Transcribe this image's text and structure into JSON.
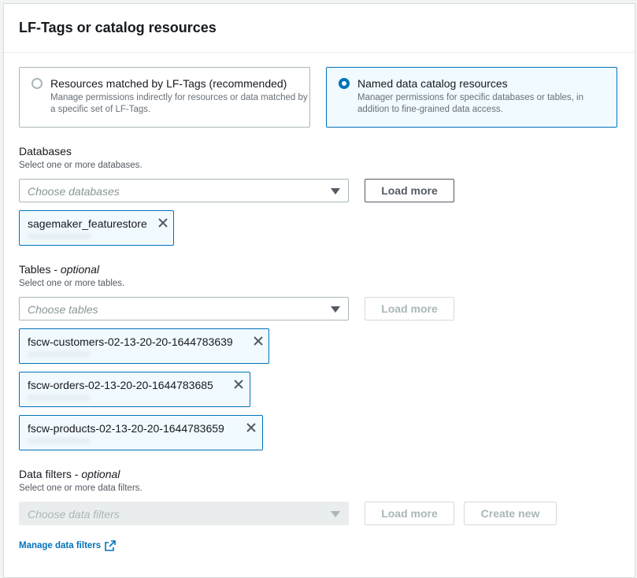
{
  "panel": {
    "title": "LF-Tags or catalog resources"
  },
  "tiles": [
    {
      "title": "Resources matched by LF-Tags (recommended)",
      "desc": "Manage permissions indirectly for resources or data matched by a specific set of LF-Tags.",
      "selected": false
    },
    {
      "title": "Named data catalog resources",
      "desc": "Manager permissions for specific databases or tables, in addition to fine-grained data access.",
      "selected": true
    }
  ],
  "databases": {
    "label": "Databases",
    "hint": "Select one or more databases.",
    "placeholder": "Choose databases",
    "load_more": "Load more",
    "tokens": [
      "sagemaker_featurestore"
    ]
  },
  "tables": {
    "label": "Tables - ",
    "optional": "optional",
    "hint": "Select one or more tables.",
    "placeholder": "Choose tables",
    "load_more": "Load more",
    "tokens": [
      "fscw-customers-02-13-20-20-1644783639",
      "fscw-orders-02-13-20-20-1644783685",
      "fscw-products-02-13-20-20-1644783659"
    ]
  },
  "filters": {
    "label": "Data filters - ",
    "optional": "optional",
    "hint": "Select one or more data filters.",
    "placeholder": "Choose data filters",
    "load_more": "Load more",
    "create_new": "Create new",
    "manage_link": "Manage data filters"
  },
  "colors": {
    "accent": "#0073bb",
    "selected_bg": "#f1faff"
  },
  "icons": {
    "remove": "close-icon",
    "external": "external-link-icon",
    "dropdown": "caret-down-icon"
  }
}
